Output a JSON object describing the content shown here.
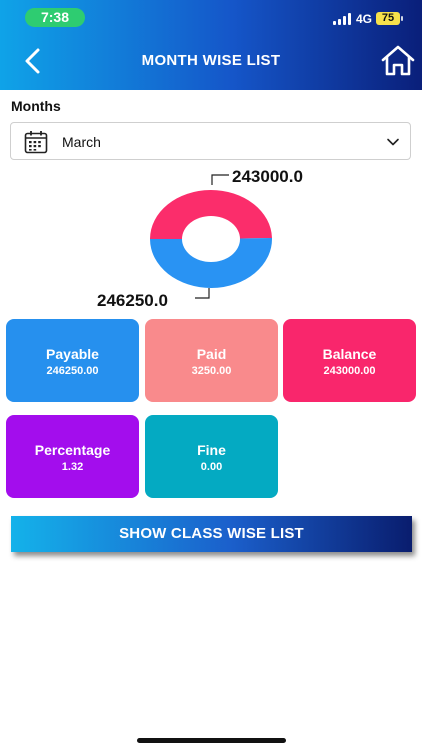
{
  "status": {
    "time": "7:38",
    "network": "4G",
    "battery": "75"
  },
  "header": {
    "title": "MONTH WISE LIST",
    "back_icon": "chevron-left-icon",
    "home_icon": "home-icon"
  },
  "months": {
    "label": "Months",
    "selected": "March",
    "icon": "calendar-icon",
    "dropdown_icon": "chevron-down-icon"
  },
  "chart_data": {
    "type": "pie",
    "labels": [
      "243000.0",
      "246250.0"
    ],
    "values": [
      243000.0,
      246250.0
    ],
    "colors": [
      "#fb2d6b",
      "#2993f3"
    ]
  },
  "cards": [
    {
      "title": "Payable",
      "value": "246250.00",
      "color": "#2690ee"
    },
    {
      "title": "Paid",
      "value": "3250.00",
      "color": "#f98a8c"
    },
    {
      "title": "Balance",
      "value": "243000.00",
      "color": "#f9266c"
    },
    {
      "title": "Percentage",
      "value": "1.32",
      "color": "#a30ded"
    },
    {
      "title": "Fine",
      "value": "0.00",
      "color": "#04aac2"
    }
  ],
  "action": {
    "label": "SHOW CLASS WISE LIST"
  }
}
